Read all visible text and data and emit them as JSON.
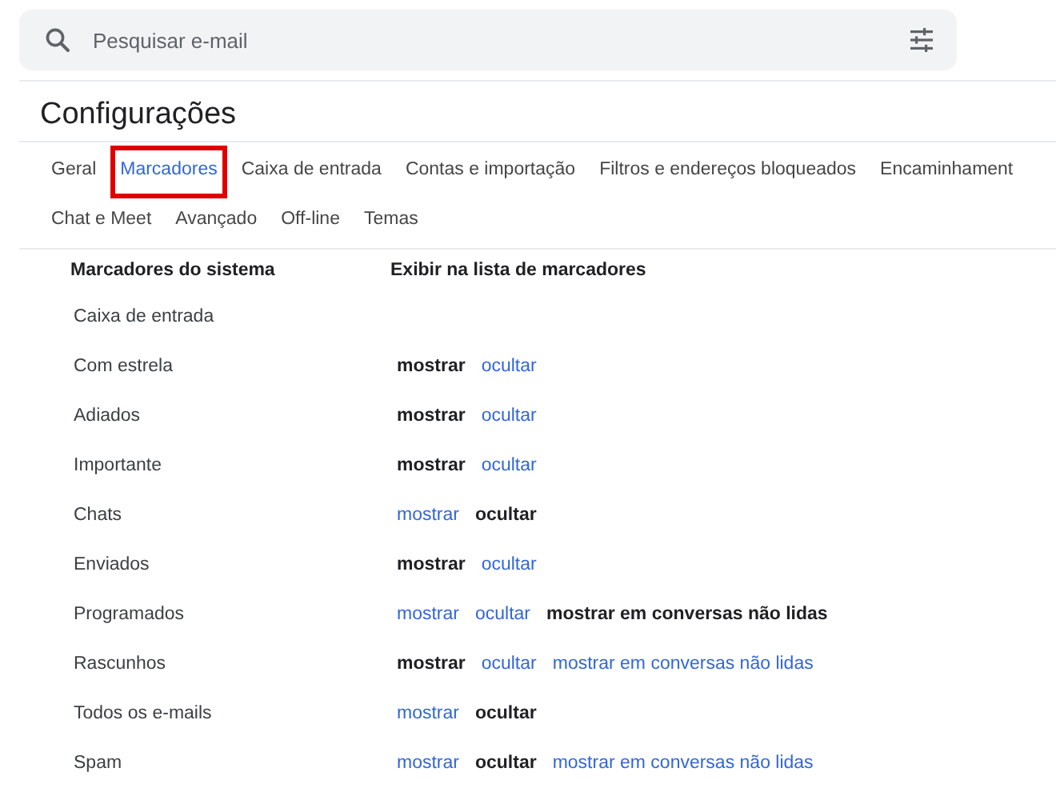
{
  "search": {
    "placeholder": "Pesquisar e-mail"
  },
  "title": "Configurações",
  "tab_rows": [
    [
      {
        "label": "Geral",
        "selected": false,
        "highlighted": false
      },
      {
        "label": "Marcadores",
        "selected": true,
        "highlighted": true
      },
      {
        "label": "Caixa de entrada",
        "selected": false,
        "highlighted": false
      },
      {
        "label": "Contas e importação",
        "selected": false,
        "highlighted": false
      },
      {
        "label": "Filtros e endereços bloqueados",
        "selected": false,
        "highlighted": false
      },
      {
        "label": "Encaminhament",
        "selected": false,
        "highlighted": false
      }
    ],
    [
      {
        "label": "Chat e Meet",
        "selected": false,
        "highlighted": false
      },
      {
        "label": "Avançado",
        "selected": false,
        "highlighted": false
      },
      {
        "label": "Off-line",
        "selected": false,
        "highlighted": false
      },
      {
        "label": "Temas",
        "selected": false,
        "highlighted": false
      }
    ]
  ],
  "table": {
    "columns": [
      "Marcadores do sistema",
      "Exibir na lista de marcadores"
    ],
    "rows": [
      {
        "name": "Caixa de entrada",
        "options": []
      },
      {
        "name": "Com estrela",
        "options": [
          {
            "label": "mostrar",
            "selected": true
          },
          {
            "label": "ocultar",
            "selected": false
          }
        ]
      },
      {
        "name": "Adiados",
        "options": [
          {
            "label": "mostrar",
            "selected": true
          },
          {
            "label": "ocultar",
            "selected": false
          }
        ]
      },
      {
        "name": "Importante",
        "options": [
          {
            "label": "mostrar",
            "selected": true
          },
          {
            "label": "ocultar",
            "selected": false
          }
        ]
      },
      {
        "name": "Chats",
        "options": [
          {
            "label": "mostrar",
            "selected": false
          },
          {
            "label": "ocultar",
            "selected": true
          }
        ]
      },
      {
        "name": "Enviados",
        "options": [
          {
            "label": "mostrar",
            "selected": true
          },
          {
            "label": "ocultar",
            "selected": false
          }
        ]
      },
      {
        "name": "Programados",
        "options": [
          {
            "label": "mostrar",
            "selected": false
          },
          {
            "label": "ocultar",
            "selected": false
          },
          {
            "label": "mostrar em conversas não lidas",
            "selected": true
          }
        ]
      },
      {
        "name": "Rascunhos",
        "options": [
          {
            "label": "mostrar",
            "selected": true
          },
          {
            "label": "ocultar",
            "selected": false
          },
          {
            "label": "mostrar em conversas não lidas",
            "selected": false
          }
        ]
      },
      {
        "name": "Todos os e-mails",
        "options": [
          {
            "label": "mostrar",
            "selected": false
          },
          {
            "label": "ocultar",
            "selected": true
          }
        ]
      },
      {
        "name": "Spam",
        "options": [
          {
            "label": "mostrar",
            "selected": false
          },
          {
            "label": "ocultar",
            "selected": true
          },
          {
            "label": "mostrar em conversas não lidas",
            "selected": false
          }
        ]
      }
    ]
  }
}
